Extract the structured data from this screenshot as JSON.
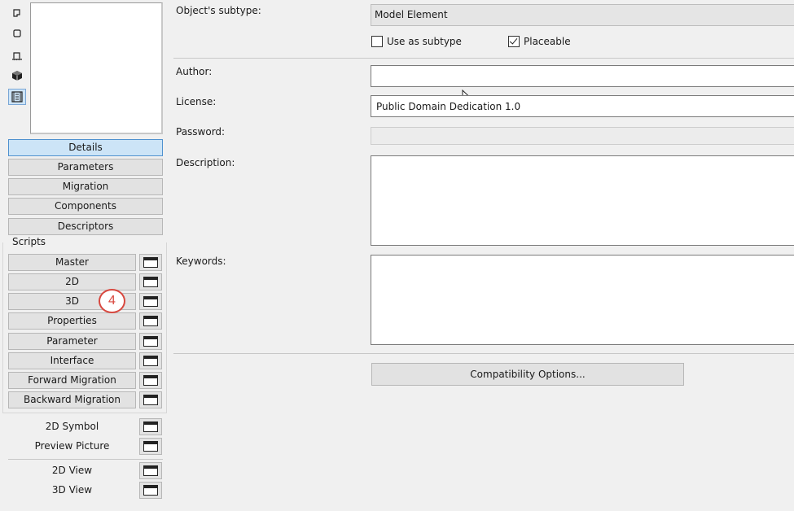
{
  "left_panel": {
    "view_icons": [
      "floor-plan-icon",
      "cube-outline-icon",
      "section-icon",
      "solid-3d-icon",
      "list-view-icon"
    ],
    "tabs": [
      {
        "label": "Details",
        "active": true
      },
      {
        "label": "Parameters",
        "active": false
      },
      {
        "label": "Migration",
        "active": false
      },
      {
        "label": "Components",
        "active": false
      },
      {
        "label": "Descriptors",
        "active": false
      }
    ],
    "scripts_heading": "Scripts",
    "scripts": [
      "Master",
      "2D",
      "3D",
      "Properties",
      "Parameter",
      "Interface",
      "Forward Migration",
      "Backward Migration"
    ],
    "extra_items": [
      "2D Symbol",
      "Preview Picture"
    ],
    "views": [
      "2D View",
      "3D View"
    ],
    "callout_badge": "4"
  },
  "details": {
    "subtype_label": "Object's subtype:",
    "subtype_value": "Model Element",
    "use_as_subtype_label": "Use as subtype",
    "use_as_subtype_checked": false,
    "placeable_label": "Placeable",
    "placeable_checked": true,
    "author_label": "Author:",
    "author_value": "",
    "license_label": "License:",
    "license_value": "Public Domain Dedication 1.0",
    "password_label": "Password:",
    "description_label": "Description:",
    "keywords_label": "Keywords:",
    "compat_button": "Compatibility Options..."
  }
}
